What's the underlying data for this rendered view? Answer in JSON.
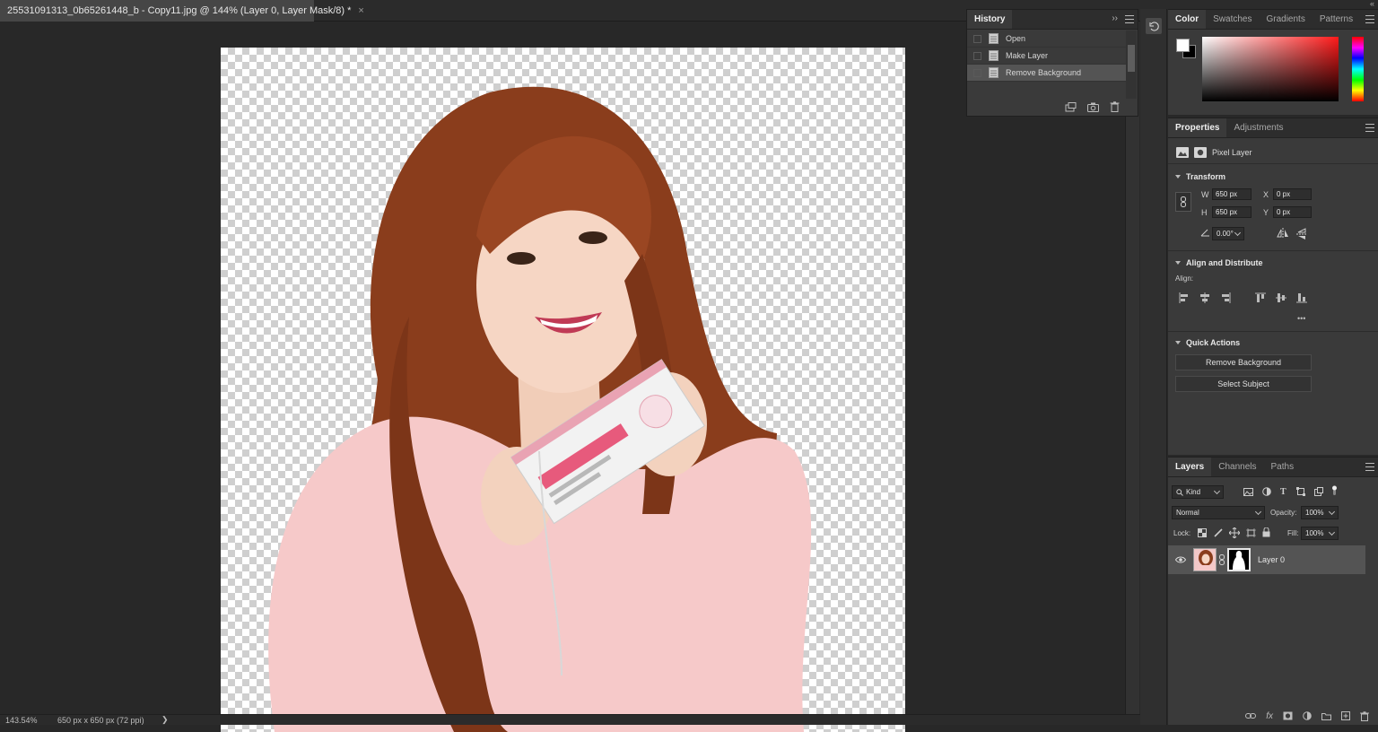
{
  "document": {
    "tab_title": "25531091313_0b65261448_b - Copy11.jpg @ 144% (Layer 0, Layer Mask/8) *",
    "close_glyph": "×"
  },
  "status": {
    "zoom": "143.54%",
    "dimensions": "650 px x 650 px (72 ppi)",
    "arrow": "❯"
  },
  "dock": {
    "collapse_glyph": "«"
  },
  "history": {
    "tab": "History",
    "expand_glyph": "››",
    "items": [
      {
        "label": "Open",
        "active": false
      },
      {
        "label": "Make Layer",
        "active": false
      },
      {
        "label": "Remove Background",
        "active": true
      }
    ]
  },
  "color_panel": {
    "tabs": [
      "Color",
      "Swatches",
      "Gradients",
      "Patterns"
    ],
    "foreground": "#ffffff",
    "background": "#000000"
  },
  "properties": {
    "tabs": [
      "Properties",
      "Adjustments"
    ],
    "layer_type": "Pixel Layer",
    "transform": {
      "title": "Transform",
      "w_label": "W",
      "w": "650 px",
      "h_label": "H",
      "h": "650 px",
      "x_label": "X",
      "x": "0 px",
      "y_label": "Y",
      "y": "0 px",
      "angle": "0.00°"
    },
    "align": {
      "title": "Align and Distribute",
      "label": "Align:",
      "more": "•••"
    },
    "quick_actions": {
      "title": "Quick Actions",
      "remove_background": "Remove Background",
      "select_subject": "Select Subject"
    }
  },
  "layers": {
    "tabs": [
      "Layers",
      "Channels",
      "Paths"
    ],
    "filter_kind": "Kind",
    "blend_mode": "Normal",
    "opacity_label": "Opacity:",
    "opacity": "100%",
    "lock_label": "Lock:",
    "fill_label": "Fill:",
    "fill": "100%",
    "items": [
      {
        "name": "Layer 0",
        "visible": true
      }
    ],
    "footer": [
      "link-layers",
      "fx",
      "add-mask",
      "adjustment",
      "group",
      "new-layer",
      "delete"
    ],
    "fx_label": "fx"
  }
}
